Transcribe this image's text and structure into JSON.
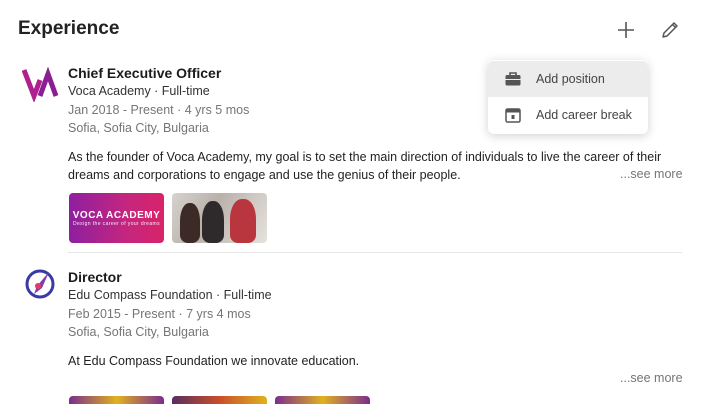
{
  "section": {
    "title": "Experience"
  },
  "header_actions": {
    "add_icon": "plus-icon",
    "edit_icon": "pencil-icon"
  },
  "dropdown": {
    "items": [
      {
        "label": "Add position",
        "icon": "briefcase-icon"
      },
      {
        "label": "Add career break",
        "icon": "calendar-icon"
      }
    ]
  },
  "experiences": [
    {
      "role": "Chief Executive Officer",
      "company": "Voca Academy · Full-time",
      "dates": "Jan 2018 - Present · 4 yrs 5 mos",
      "location": "Sofia, Sofia City, Bulgaria",
      "description": "As the founder of Voca Academy, my goal is to set the main direction of individuals to live the career of their dreams and corporations to engage and use the genius of their people.",
      "see_more": "...see more",
      "media_label": "VOCA ACADEMY",
      "media_tagline": "Design the career of your dreams",
      "logo_icon": "voca-academy-logo",
      "brand_color": "#b01f8e"
    },
    {
      "role": "Director",
      "company": "Edu Compass Foundation · Full-time",
      "dates": "Feb 2015 - Present · 7 yrs 4 mos",
      "location": "Sofia, Sofia City, Bulgaria",
      "description": "At Edu Compass Foundation we innovate education.",
      "see_more": "...see more",
      "logo_icon": "edu-compass-logo",
      "brand_color": "#3a3aa5"
    }
  ]
}
